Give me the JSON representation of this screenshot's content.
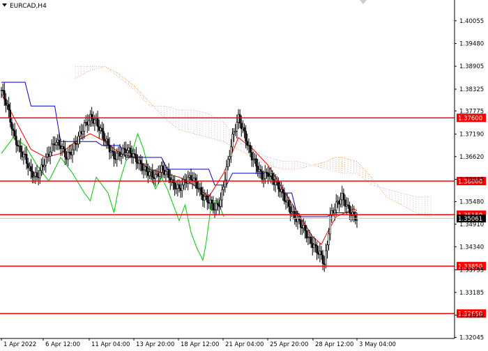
{
  "symbol": "EURCAD,H4",
  "colors": {
    "background": "#ffffff",
    "axis": "#000000",
    "level_line": "#ff0000",
    "level_label_bg": "#ff0000",
    "level_label_text": "#ffffff",
    "price_label_bg": "#000000",
    "price_label_text": "#ffffff",
    "candles": "#000000",
    "tenkan": "#ff0000",
    "kijun": "#0000cc",
    "chikou": "#00cc00",
    "cloud_span_a": "#f4a460",
    "cloud_span_b": "#d8bfd8"
  },
  "chart_data": {
    "type": "candlestick",
    "ylim": [
      1.3202,
      1.4058
    ],
    "y_ticks": [
      "1.40055",
      "1.39480",
      "1.38905",
      "1.38325",
      "1.37775",
      "1.37190",
      "1.36620",
      "1.36045",
      "1.35480",
      "1.34910",
      "1.34340",
      "1.33755",
      "1.33185",
      "1.32610",
      "1.32045"
    ],
    "x_ticks": [
      "1 Apr 2022",
      "6 Apr 12:00",
      "11 Apr 04:00",
      "13 Apr 20:00",
      "18 Apr 12:00",
      "21 Apr 04:00",
      "25 Apr 20:00",
      "28 Apr 12:00",
      "3 May 04:00"
    ],
    "levels": [
      {
        "label": "1.37600",
        "value": 1.376
      },
      {
        "label": "1.36000",
        "value": 1.36
      },
      {
        "label": "1.35150",
        "value": 1.3515
      },
      {
        "label": "1.33850",
        "value": 1.3385
      },
      {
        "label": "1.32650",
        "value": 1.3265
      }
    ],
    "current_price": {
      "label": "1.35061",
      "value": 1.35061
    },
    "indicator": "Ichimoku Kinko Hyo",
    "price_path": [
      [
        0,
        1.383
      ],
      [
        4,
        1.379
      ],
      [
        8,
        1.372
      ],
      [
        12,
        1.368
      ],
      [
        16,
        1.366
      ],
      [
        20,
        1.362
      ],
      [
        24,
        1.361
      ],
      [
        28,
        1.364
      ],
      [
        32,
        1.367
      ],
      [
        36,
        1.37
      ],
      [
        40,
        1.369
      ],
      [
        44,
        1.366
      ],
      [
        48,
        1.368
      ],
      [
        52,
        1.371
      ],
      [
        56,
        1.374
      ],
      [
        60,
        1.376
      ],
      [
        64,
        1.375
      ],
      [
        68,
        1.372
      ],
      [
        72,
        1.369
      ],
      [
        76,
        1.366
      ],
      [
        80,
        1.367
      ],
      [
        84,
        1.368
      ],
      [
        88,
        1.367
      ],
      [
        92,
        1.365
      ],
      [
        96,
        1.363
      ],
      [
        100,
        1.362
      ],
      [
        104,
        1.361
      ],
      [
        108,
        1.363
      ],
      [
        112,
        1.362
      ],
      [
        116,
        1.359
      ],
      [
        120,
        1.358
      ],
      [
        124,
        1.36
      ],
      [
        128,
        1.361
      ],
      [
        132,
        1.359
      ],
      [
        136,
        1.356
      ],
      [
        140,
        1.355
      ],
      [
        144,
        1.353
      ],
      [
        148,
        1.355
      ],
      [
        152,
        1.363
      ],
      [
        156,
        1.371
      ],
      [
        160,
        1.376
      ],
      [
        164,
        1.372
      ],
      [
        168,
        1.367
      ],
      [
        172,
        1.364
      ],
      [
        176,
        1.361
      ],
      [
        180,
        1.362
      ],
      [
        184,
        1.36
      ],
      [
        188,
        1.358
      ],
      [
        192,
        1.355
      ],
      [
        196,
        1.352
      ],
      [
        200,
        1.35
      ],
      [
        204,
        1.348
      ],
      [
        208,
        1.345
      ],
      [
        212,
        1.343
      ],
      [
        216,
        1.341
      ],
      [
        218,
        1.339
      ],
      [
        220,
        1.344
      ],
      [
        222,
        1.351
      ],
      [
        226,
        1.354
      ],
      [
        230,
        1.356
      ],
      [
        234,
        1.353
      ],
      [
        238,
        1.351
      ],
      [
        240,
        1.3506
      ]
    ],
    "tenkan_path": [
      [
        0,
        1.382
      ],
      [
        10,
        1.375
      ],
      [
        20,
        1.368
      ],
      [
        30,
        1.366
      ],
      [
        40,
        1.367
      ],
      [
        50,
        1.37
      ],
      [
        60,
        1.372
      ],
      [
        70,
        1.37
      ],
      [
        80,
        1.367
      ],
      [
        90,
        1.366
      ],
      [
        100,
        1.363
      ],
      [
        110,
        1.362
      ],
      [
        120,
        1.361
      ],
      [
        130,
        1.359
      ],
      [
        140,
        1.356
      ],
      [
        150,
        1.362
      ],
      [
        160,
        1.371
      ],
      [
        170,
        1.368
      ],
      [
        180,
        1.364
      ],
      [
        190,
        1.358
      ],
      [
        200,
        1.352
      ],
      [
        210,
        1.346
      ],
      [
        216,
        1.344
      ],
      [
        220,
        1.347
      ],
      [
        226,
        1.351
      ],
      [
        232,
        1.352
      ],
      [
        238,
        1.353
      ],
      [
        240,
        1.3525
      ]
    ],
    "kijun_path": [
      [
        0,
        1.385
      ],
      [
        16,
        1.385
      ],
      [
        20,
        1.379
      ],
      [
        36,
        1.379
      ],
      [
        40,
        1.37
      ],
      [
        64,
        1.37
      ],
      [
        68,
        1.369
      ],
      [
        80,
        1.369
      ],
      [
        84,
        1.366
      ],
      [
        108,
        1.366
      ],
      [
        112,
        1.363
      ],
      [
        140,
        1.363
      ],
      [
        144,
        1.359
      ],
      [
        152,
        1.359
      ],
      [
        156,
        1.362
      ],
      [
        180,
        1.362
      ],
      [
        184,
        1.36
      ],
      [
        190,
        1.357
      ],
      [
        196,
        1.357
      ],
      [
        200,
        1.351
      ],
      [
        220,
        1.351
      ],
      [
        224,
        1.352
      ],
      [
        240,
        1.352
      ]
    ],
    "chikou_path": [
      [
        0,
        1.367
      ],
      [
        8,
        1.371
      ],
      [
        16,
        1.369
      ],
      [
        24,
        1.364
      ],
      [
        32,
        1.36
      ],
      [
        40,
        1.366
      ],
      [
        48,
        1.362
      ],
      [
        56,
        1.357
      ],
      [
        60,
        1.355
      ],
      [
        64,
        1.361
      ],
      [
        72,
        1.357
      ],
      [
        76,
        1.352
      ],
      [
        80,
        1.36
      ],
      [
        84,
        1.365
      ],
      [
        88,
        1.367
      ],
      [
        92,
        1.372
      ],
      [
        96,
        1.368
      ],
      [
        100,
        1.362
      ],
      [
        104,
        1.358
      ],
      [
        108,
        1.361
      ],
      [
        112,
        1.358
      ],
      [
        116,
        1.354
      ],
      [
        120,
        1.35
      ],
      [
        124,
        1.354
      ],
      [
        128,
        1.347
      ],
      [
        132,
        1.343
      ],
      [
        136,
        1.34
      ],
      [
        138,
        1.344
      ],
      [
        142,
        1.355
      ],
      [
        146,
        1.355
      ],
      [
        150,
        1.351
      ]
    ],
    "cloud_a_path": [
      [
        0,
        1.386
      ],
      [
        10,
        1.388
      ],
      [
        20,
        1.389
      ],
      [
        30,
        1.387
      ],
      [
        40,
        1.384
      ],
      [
        50,
        1.38
      ],
      [
        60,
        1.376
      ],
      [
        70,
        1.373
      ],
      [
        80,
        1.372
      ],
      [
        90,
        1.371
      ],
      [
        100,
        1.37
      ],
      [
        110,
        1.368
      ],
      [
        120,
        1.366
      ],
      [
        130,
        1.364
      ],
      [
        140,
        1.363
      ],
      [
        150,
        1.363
      ],
      [
        160,
        1.364
      ],
      [
        170,
        1.365
      ],
      [
        175,
        1.366
      ],
      [
        180,
        1.366
      ],
      [
        190,
        1.365
      ],
      [
        200,
        1.361
      ],
      [
        210,
        1.356
      ],
      [
        220,
        1.354
      ],
      [
        230,
        1.352
      ],
      [
        240,
        1.351
      ]
    ],
    "cloud_b_path": [
      [
        0,
        1.389
      ],
      [
        20,
        1.389
      ],
      [
        30,
        1.386
      ],
      [
        40,
        1.383
      ],
      [
        50,
        1.379
      ],
      [
        60,
        1.379
      ],
      [
        70,
        1.378
      ],
      [
        80,
        1.378
      ],
      [
        90,
        1.377
      ],
      [
        100,
        1.375
      ],
      [
        110,
        1.37
      ],
      [
        120,
        1.368
      ],
      [
        130,
        1.366
      ],
      [
        140,
        1.365
      ],
      [
        150,
        1.365
      ],
      [
        160,
        1.364
      ],
      [
        170,
        1.363
      ],
      [
        180,
        1.362
      ],
      [
        190,
        1.362
      ],
      [
        200,
        1.359
      ],
      [
        210,
        1.358
      ],
      [
        220,
        1.357
      ],
      [
        230,
        1.356
      ],
      [
        240,
        1.356
      ]
    ]
  }
}
